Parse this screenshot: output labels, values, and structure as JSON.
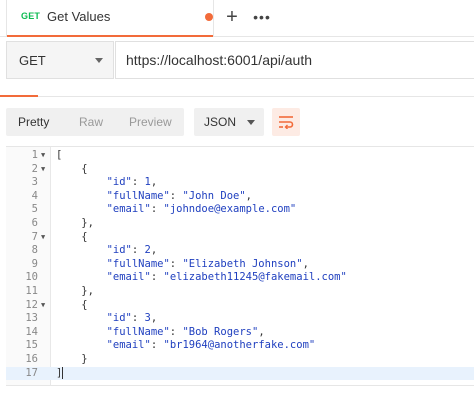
{
  "tab": {
    "method": "GET",
    "title": "Get Values",
    "add_label": "+",
    "more_label": "•••"
  },
  "request": {
    "method": "GET",
    "url": "https://localhost:6001/api/auth"
  },
  "response_toolbar": {
    "views": [
      "Pretty",
      "Raw",
      "Preview"
    ],
    "active_view": "Pretty",
    "format": "JSON"
  },
  "colors": {
    "accent": "#f26b3a",
    "method_get": "#0cbb52",
    "json_value": "#1f3fbf"
  },
  "body_lines": [
    {
      "n": "1",
      "fold": true,
      "t": [
        [
          "p",
          "["
        ]
      ]
    },
    {
      "n": "2",
      "fold": true,
      "t": [
        [
          "p",
          "    {"
        ]
      ]
    },
    {
      "n": "3",
      "t": [
        [
          "p",
          "        "
        ],
        [
          "k",
          "\"id\""
        ],
        [
          "p",
          ": "
        ],
        [
          "n",
          "1"
        ],
        [
          "p",
          ","
        ]
      ]
    },
    {
      "n": "4",
      "t": [
        [
          "p",
          "        "
        ],
        [
          "k",
          "\"fullName\""
        ],
        [
          "p",
          ": "
        ],
        [
          "s",
          "\"John Doe\""
        ],
        [
          "p",
          ","
        ]
      ]
    },
    {
      "n": "5",
      "t": [
        [
          "p",
          "        "
        ],
        [
          "k",
          "\"email\""
        ],
        [
          "p",
          ": "
        ],
        [
          "s",
          "\"johndoe@example.com\""
        ]
      ]
    },
    {
      "n": "6",
      "t": [
        [
          "p",
          "    },"
        ]
      ]
    },
    {
      "n": "7",
      "fold": true,
      "t": [
        [
          "p",
          "    {"
        ]
      ]
    },
    {
      "n": "8",
      "t": [
        [
          "p",
          "        "
        ],
        [
          "k",
          "\"id\""
        ],
        [
          "p",
          ": "
        ],
        [
          "n",
          "2"
        ],
        [
          "p",
          ","
        ]
      ]
    },
    {
      "n": "9",
      "t": [
        [
          "p",
          "        "
        ],
        [
          "k",
          "\"fullName\""
        ],
        [
          "p",
          ": "
        ],
        [
          "s",
          "\"Elizabeth Johnson\""
        ],
        [
          "p",
          ","
        ]
      ]
    },
    {
      "n": "10",
      "t": [
        [
          "p",
          "        "
        ],
        [
          "k",
          "\"email\""
        ],
        [
          "p",
          ": "
        ],
        [
          "s",
          "\"elizabeth11245@fakemail.com\""
        ]
      ]
    },
    {
      "n": "11",
      "t": [
        [
          "p",
          "    },"
        ]
      ]
    },
    {
      "n": "12",
      "fold": true,
      "t": [
        [
          "p",
          "    {"
        ]
      ]
    },
    {
      "n": "13",
      "t": [
        [
          "p",
          "        "
        ],
        [
          "k",
          "\"id\""
        ],
        [
          "p",
          ": "
        ],
        [
          "n",
          "3"
        ],
        [
          "p",
          ","
        ]
      ]
    },
    {
      "n": "14",
      "t": [
        [
          "p",
          "        "
        ],
        [
          "k",
          "\"fullName\""
        ],
        [
          "p",
          ": "
        ],
        [
          "s",
          "\"Bob Rogers\""
        ],
        [
          "p",
          ","
        ]
      ]
    },
    {
      "n": "15",
      "t": [
        [
          "p",
          "        "
        ],
        [
          "k",
          "\"email\""
        ],
        [
          "p",
          ": "
        ],
        [
          "s",
          "\"br1964@anotherfake.com\""
        ]
      ]
    },
    {
      "n": "16",
      "t": [
        [
          "p",
          "    }"
        ]
      ]
    },
    {
      "n": "17",
      "active": true,
      "t": [
        [
          "p",
          "]"
        ]
      ]
    }
  ]
}
